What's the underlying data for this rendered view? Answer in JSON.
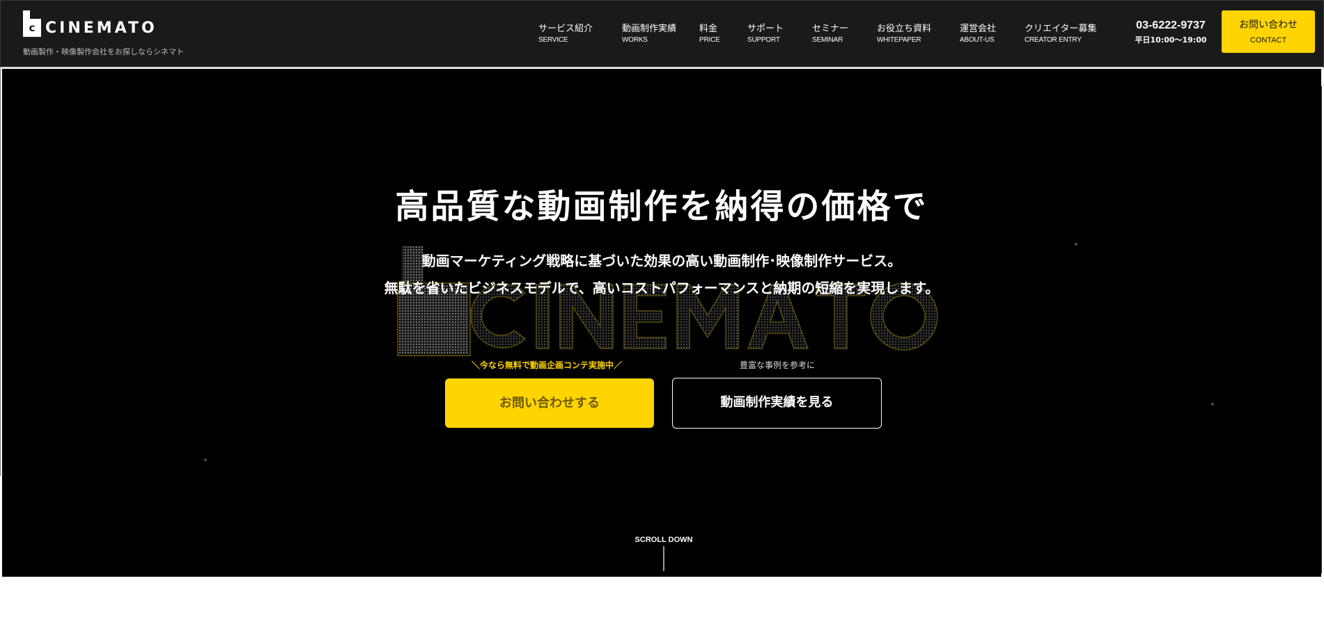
{
  "header": {
    "logo_text": "CINEMATO",
    "logo_mark_letter": "c",
    "tagline": "動画製作・映像製作会社をお探しならシネマト",
    "nav": [
      {
        "ja": "サービス紹介",
        "en": "SERVICE"
      },
      {
        "ja": "動画制作実績",
        "en": "WORKS"
      },
      {
        "ja": "料金",
        "en": "PRICE"
      },
      {
        "ja": "サポート",
        "en": "SUPPORT"
      },
      {
        "ja": "セミナー",
        "en": "SEMINAR"
      },
      {
        "ja": "お役立ち資料",
        "en": "WHITEPAPER"
      },
      {
        "ja": "運営会社",
        "en": "ABOUT-US"
      },
      {
        "ja": "クリエイター募集",
        "en": "CREATOR ENTRY"
      }
    ],
    "phone": {
      "number": "03-6222-9737",
      "hours": "平日10:00〜19:00"
    },
    "contact": {
      "ja": "お問い合わせ",
      "en": "CONTACT"
    }
  },
  "hero": {
    "headline": "高品質な動画制作を納得の価格で",
    "lead_line1": "動画マーケティング戦略に基づいた効果の高い動画制作･映像制作サービス。",
    "lead_line2": "無駄を省いたビジネスモデルで、高いコストパフォーマンスと納期の短縮を実現します。",
    "cta_inquiry": {
      "note": "＼今なら無料で動画企画コンテ実施中／",
      "label": "お問い合わせする"
    },
    "cta_works": {
      "note": "豊富な事例を参考に",
      "label": "動画制作実績を見る"
    },
    "scroll_label": "SCROLL DOWN"
  },
  "colors": {
    "header_bg": "#1a1a1a",
    "hero_bg": "#000000",
    "accent_yellow": "#ffd400",
    "text_white": "#ffffff"
  }
}
